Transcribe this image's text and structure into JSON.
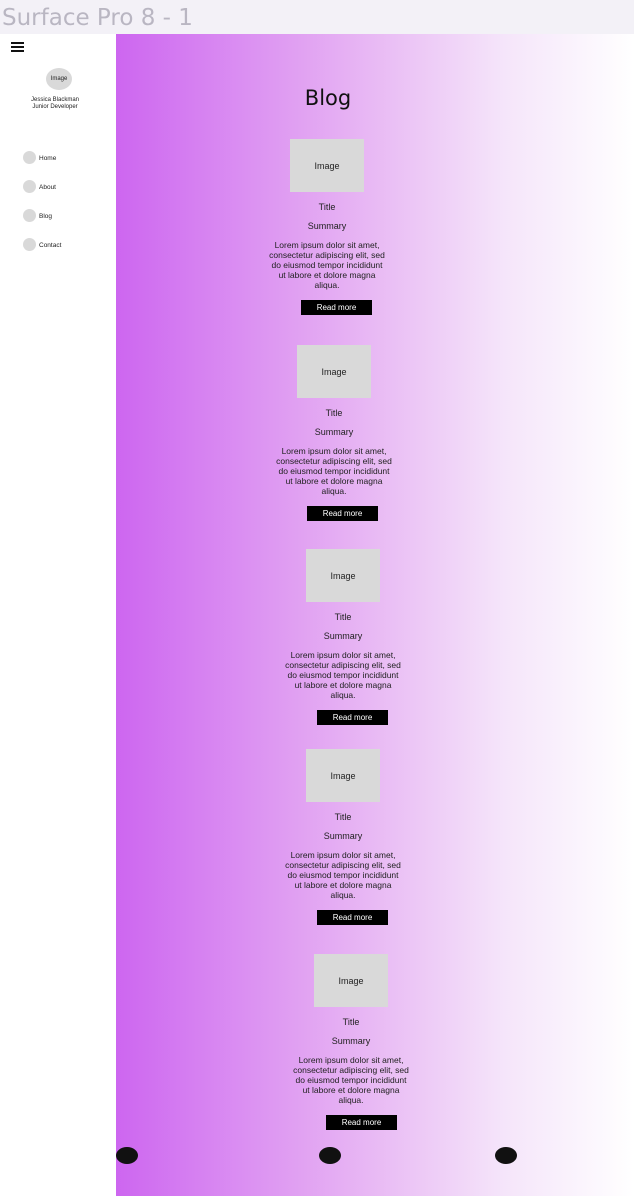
{
  "frame_label": "Surface Pro 8 - 1",
  "sidebar": {
    "avatar_label": "Image",
    "name": "Jessica Blackman",
    "role": "Junior Developer",
    "nav": [
      {
        "label": "Home"
      },
      {
        "label": "About"
      },
      {
        "label": "Blog"
      },
      {
        "label": "Contact"
      }
    ]
  },
  "main": {
    "heading": "Blog",
    "posts": [
      {
        "image": "Image",
        "title": "Title",
        "summary": "Summary",
        "body": "Lorem ipsum dolor sit amet, consectetur adipiscing elit, sed do eiusmod tempor incididunt ut labore et dolore magna aliqua.",
        "button": "Read more"
      },
      {
        "image": "Image",
        "title": "Title",
        "summary": "Summary",
        "body": "Lorem ipsum dolor sit amet, consectetur adipiscing elit, sed do eiusmod tempor incididunt ut labore et dolore magna aliqua.",
        "button": "Read more"
      },
      {
        "image": "Image",
        "title": "Title",
        "summary": "Summary",
        "body": "Lorem ipsum dolor sit amet, consectetur adipiscing elit, sed do eiusmod tempor incididunt ut labore et dolore magna aliqua.",
        "button": "Read more"
      },
      {
        "image": "Image",
        "title": "Title",
        "summary": "Summary",
        "body": "Lorem ipsum dolor sit amet, consectetur adipiscing elit, sed do eiusmod tempor incididunt ut labore et dolore magna aliqua.",
        "button": "Read more"
      },
      {
        "image": "Image",
        "title": "Title",
        "summary": "Summary",
        "body": "Lorem ipsum dolor sit amet, consectetur adipiscing elit, sed do eiusmod tempor incididunt ut labore et dolore magna aliqua.",
        "button": "Read more"
      }
    ]
  },
  "colors": {
    "gradient_start": "#cd66f0",
    "gradient_end": "#ffffff",
    "button_bg": "#000000",
    "placeholder": "#d9d9d9"
  },
  "icons": [
    "menu-icon"
  ]
}
